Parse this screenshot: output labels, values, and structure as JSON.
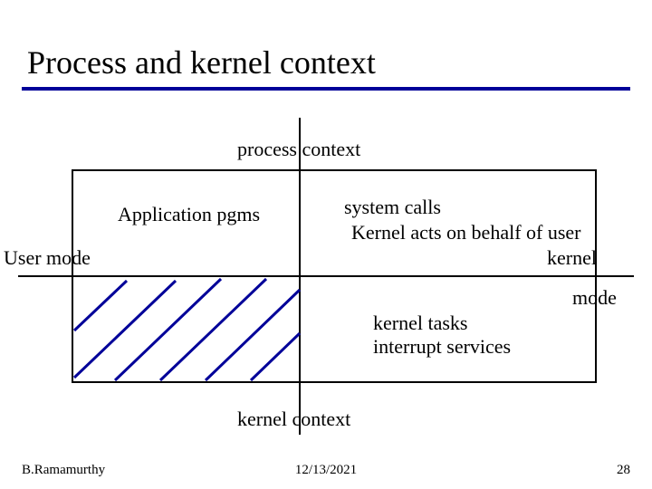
{
  "title": "Process and kernel context",
  "labels": {
    "process_context": "process context",
    "application_pgms": "Application pgms",
    "user_mode": "User mode",
    "system_calls": "system calls",
    "kernel_acts": "Kernel acts on behalf of user",
    "kernel_right": "kernel",
    "mode_right": "mode",
    "kernel_tasks": "kernel tasks",
    "interrupt_services": "interrupt services",
    "kernel_context": "kernel context"
  },
  "footer": {
    "author": "B.Ramamurthy",
    "date": "12/13/2021",
    "page": "28"
  }
}
